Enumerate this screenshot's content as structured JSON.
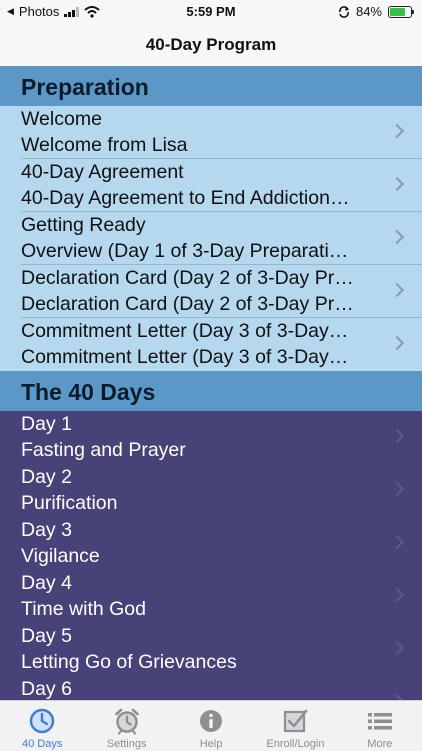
{
  "status_bar": {
    "back_app": "Photos",
    "time": "5:59 PM",
    "battery": "84%"
  },
  "nav": {
    "title": "40-Day Program"
  },
  "sections": [
    {
      "title": "Preparation",
      "rows": [
        {
          "title": "Welcome",
          "subtitle": "Welcome from Lisa"
        },
        {
          "title": "40-Day Agreement",
          "subtitle": "40-Day Agreement to End Addiction…"
        },
        {
          "title": "Getting Ready",
          "subtitle": "Overview (Day 1 of 3-Day Preparati…"
        },
        {
          "title": "Declaration Card (Day 2 of 3-Day Pr…",
          "subtitle": "Declaration Card (Day 2 of 3-Day Pr…"
        },
        {
          "title": "Commitment Letter (Day 3 of 3-Day…",
          "subtitle": "Commitment Letter (Day 3 of 3-Day…"
        }
      ]
    },
    {
      "title": "The 40 Days",
      "rows": [
        {
          "title": "Day 1",
          "subtitle": "Fasting and Prayer"
        },
        {
          "title": "Day 2",
          "subtitle": "Purification"
        },
        {
          "title": "Day 3",
          "subtitle": "Vigilance"
        },
        {
          "title": "Day 4",
          "subtitle": "Time with God"
        },
        {
          "title": "Day 5",
          "subtitle": "Letting Go of Grievances"
        },
        {
          "title": "Day 6",
          "subtitle": ""
        }
      ]
    }
  ],
  "tabs": [
    {
      "label": "40 Days",
      "icon": "clock-icon"
    },
    {
      "label": "Settings",
      "icon": "alarm-clock-icon"
    },
    {
      "label": "Help",
      "icon": "info-icon"
    },
    {
      "label": "Enroll/Login",
      "icon": "checkbox-icon"
    },
    {
      "label": "More",
      "icon": "list-icon"
    }
  ],
  "colors": {
    "section_header": "#5b98c8",
    "preparation_rows": "#b5d8ef",
    "days_rows": "#474379",
    "tab_active": "#3b7dd8",
    "tab_inactive": "#8e8e93",
    "battery": "#33c14b"
  }
}
